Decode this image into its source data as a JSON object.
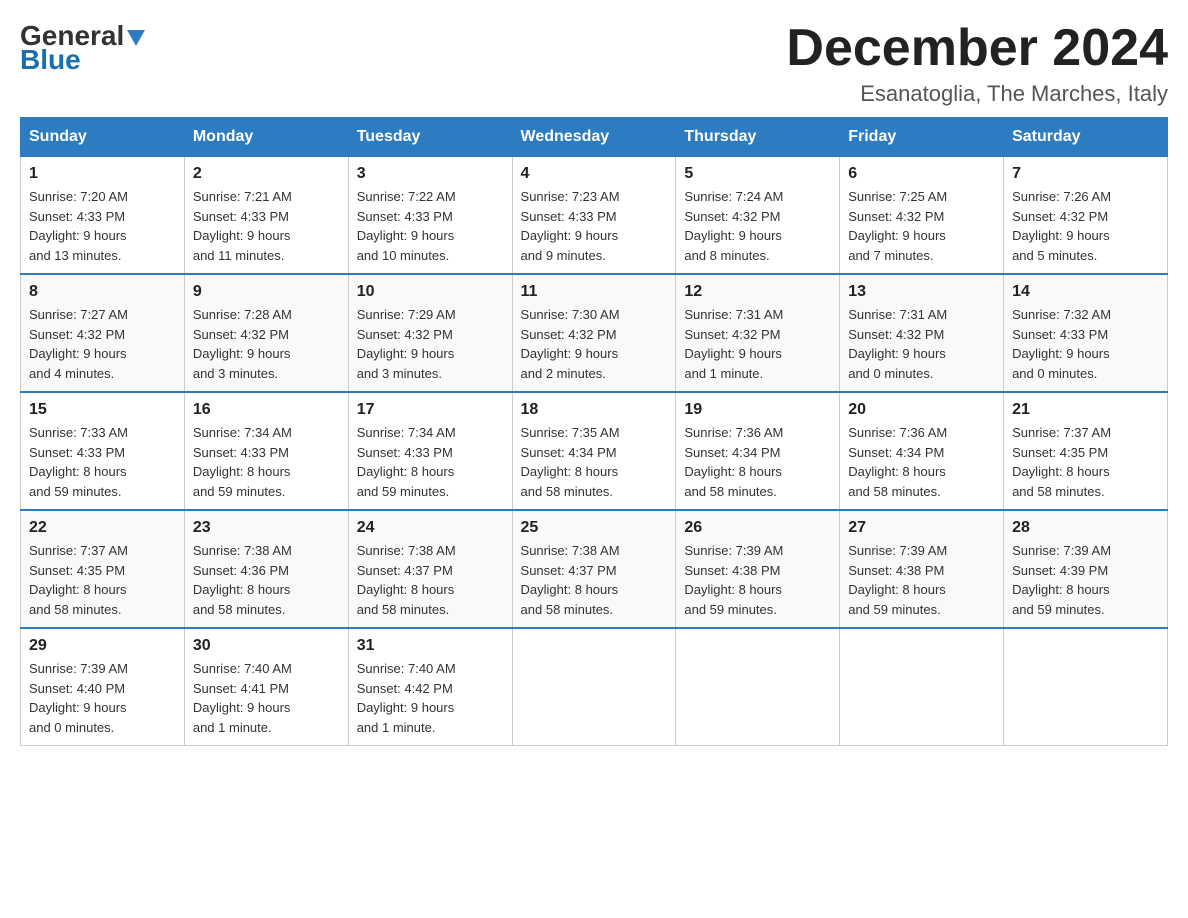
{
  "logo": {
    "general": "General",
    "blue": "Blue"
  },
  "title": {
    "month_year": "December 2024",
    "location": "Esanatoglia, The Marches, Italy"
  },
  "weekdays": [
    "Sunday",
    "Monday",
    "Tuesday",
    "Wednesday",
    "Thursday",
    "Friday",
    "Saturday"
  ],
  "weeks": [
    [
      {
        "day": "1",
        "sunrise": "7:20 AM",
        "sunset": "4:33 PM",
        "daylight": "9 hours and 13 minutes."
      },
      {
        "day": "2",
        "sunrise": "7:21 AM",
        "sunset": "4:33 PM",
        "daylight": "9 hours and 11 minutes."
      },
      {
        "day": "3",
        "sunrise": "7:22 AM",
        "sunset": "4:33 PM",
        "daylight": "9 hours and 10 minutes."
      },
      {
        "day": "4",
        "sunrise": "7:23 AM",
        "sunset": "4:33 PM",
        "daylight": "9 hours and 9 minutes."
      },
      {
        "day": "5",
        "sunrise": "7:24 AM",
        "sunset": "4:32 PM",
        "daylight": "9 hours and 8 minutes."
      },
      {
        "day": "6",
        "sunrise": "7:25 AM",
        "sunset": "4:32 PM",
        "daylight": "9 hours and 7 minutes."
      },
      {
        "day": "7",
        "sunrise": "7:26 AM",
        "sunset": "4:32 PM",
        "daylight": "9 hours and 5 minutes."
      }
    ],
    [
      {
        "day": "8",
        "sunrise": "7:27 AM",
        "sunset": "4:32 PM",
        "daylight": "9 hours and 4 minutes."
      },
      {
        "day": "9",
        "sunrise": "7:28 AM",
        "sunset": "4:32 PM",
        "daylight": "9 hours and 3 minutes."
      },
      {
        "day": "10",
        "sunrise": "7:29 AM",
        "sunset": "4:32 PM",
        "daylight": "9 hours and 3 minutes."
      },
      {
        "day": "11",
        "sunrise": "7:30 AM",
        "sunset": "4:32 PM",
        "daylight": "9 hours and 2 minutes."
      },
      {
        "day": "12",
        "sunrise": "7:31 AM",
        "sunset": "4:32 PM",
        "daylight": "9 hours and 1 minute."
      },
      {
        "day": "13",
        "sunrise": "7:31 AM",
        "sunset": "4:32 PM",
        "daylight": "9 hours and 0 minutes."
      },
      {
        "day": "14",
        "sunrise": "7:32 AM",
        "sunset": "4:33 PM",
        "daylight": "9 hours and 0 minutes."
      }
    ],
    [
      {
        "day": "15",
        "sunrise": "7:33 AM",
        "sunset": "4:33 PM",
        "daylight": "8 hours and 59 minutes."
      },
      {
        "day": "16",
        "sunrise": "7:34 AM",
        "sunset": "4:33 PM",
        "daylight": "8 hours and 59 minutes."
      },
      {
        "day": "17",
        "sunrise": "7:34 AM",
        "sunset": "4:33 PM",
        "daylight": "8 hours and 59 minutes."
      },
      {
        "day": "18",
        "sunrise": "7:35 AM",
        "sunset": "4:34 PM",
        "daylight": "8 hours and 58 minutes."
      },
      {
        "day": "19",
        "sunrise": "7:36 AM",
        "sunset": "4:34 PM",
        "daylight": "8 hours and 58 minutes."
      },
      {
        "day": "20",
        "sunrise": "7:36 AM",
        "sunset": "4:34 PM",
        "daylight": "8 hours and 58 minutes."
      },
      {
        "day": "21",
        "sunrise": "7:37 AM",
        "sunset": "4:35 PM",
        "daylight": "8 hours and 58 minutes."
      }
    ],
    [
      {
        "day": "22",
        "sunrise": "7:37 AM",
        "sunset": "4:35 PM",
        "daylight": "8 hours and 58 minutes."
      },
      {
        "day": "23",
        "sunrise": "7:38 AM",
        "sunset": "4:36 PM",
        "daylight": "8 hours and 58 minutes."
      },
      {
        "day": "24",
        "sunrise": "7:38 AM",
        "sunset": "4:37 PM",
        "daylight": "8 hours and 58 minutes."
      },
      {
        "day": "25",
        "sunrise": "7:38 AM",
        "sunset": "4:37 PM",
        "daylight": "8 hours and 58 minutes."
      },
      {
        "day": "26",
        "sunrise": "7:39 AM",
        "sunset": "4:38 PM",
        "daylight": "8 hours and 59 minutes."
      },
      {
        "day": "27",
        "sunrise": "7:39 AM",
        "sunset": "4:38 PM",
        "daylight": "8 hours and 59 minutes."
      },
      {
        "day": "28",
        "sunrise": "7:39 AM",
        "sunset": "4:39 PM",
        "daylight": "8 hours and 59 minutes."
      }
    ],
    [
      {
        "day": "29",
        "sunrise": "7:39 AM",
        "sunset": "4:40 PM",
        "daylight": "9 hours and 0 minutes."
      },
      {
        "day": "30",
        "sunrise": "7:40 AM",
        "sunset": "4:41 PM",
        "daylight": "9 hours and 1 minute."
      },
      {
        "day": "31",
        "sunrise": "7:40 AM",
        "sunset": "4:42 PM",
        "daylight": "9 hours and 1 minute."
      },
      null,
      null,
      null,
      null
    ]
  ],
  "labels": {
    "sunrise": "Sunrise:",
    "sunset": "Sunset:",
    "daylight": "Daylight:"
  }
}
